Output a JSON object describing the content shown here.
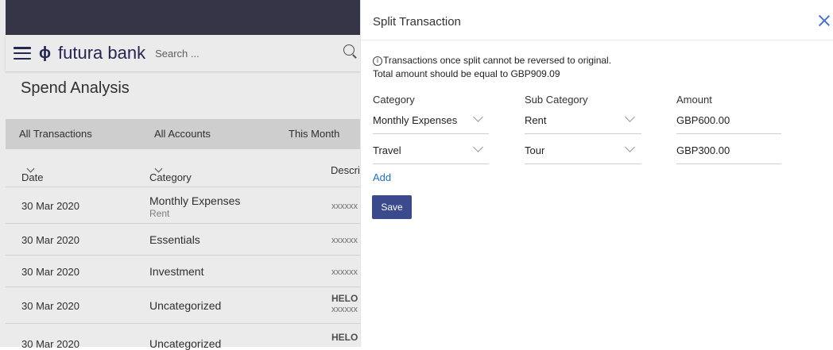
{
  "header": {
    "brand": "futura bank",
    "search_placeholder": "Search ..."
  },
  "page": {
    "title": "Spend Analysis"
  },
  "filters": [
    "All Transactions",
    "All Accounts",
    "This Month"
  ],
  "table": {
    "columns": [
      "Date",
      "Category",
      "Descri"
    ],
    "rows": [
      {
        "date": "30 Mar 2020",
        "category": "Monthly Expenses",
        "sub": "Rent",
        "desc": "xxxxxx",
        "desc2": ""
      },
      {
        "date": "30 Mar 2020",
        "category": "Essentials",
        "sub": "",
        "desc": "xxxxxx",
        "desc2": ""
      },
      {
        "date": "30 Mar 2020",
        "category": "Investment",
        "sub": "",
        "desc": "xxxxxx",
        "desc2": ""
      },
      {
        "date": "30 Mar 2020",
        "category": "Uncategorized",
        "sub": "",
        "desc": "HELO",
        "desc2": "xxxxxx"
      },
      {
        "date": "30 Mar 2020",
        "category": "Uncategorized",
        "sub": "",
        "desc": "HELO",
        "desc2": ""
      }
    ]
  },
  "panel": {
    "title": "Split Transaction",
    "note_line1": "Transactions once split cannot be reversed to original.",
    "note_line2": "Total amount should be equal to GBP909.09",
    "info_glyph": "i",
    "col_category": "Category",
    "col_subcategory": "Sub Category",
    "col_amount": "Amount",
    "splits": [
      {
        "category": "Monthly Expenses",
        "subcategory": "Rent",
        "amount": "GBP600.00"
      },
      {
        "category": "Travel",
        "subcategory": "Tour",
        "amount": "GBP300.00"
      }
    ],
    "add_label": "Add",
    "save_label": "Save"
  },
  "colors": {
    "accent": "#3a4a8c",
    "link": "#1f6fc4",
    "close": "#4a6fd0",
    "topbar": "#3a3a4e"
  }
}
